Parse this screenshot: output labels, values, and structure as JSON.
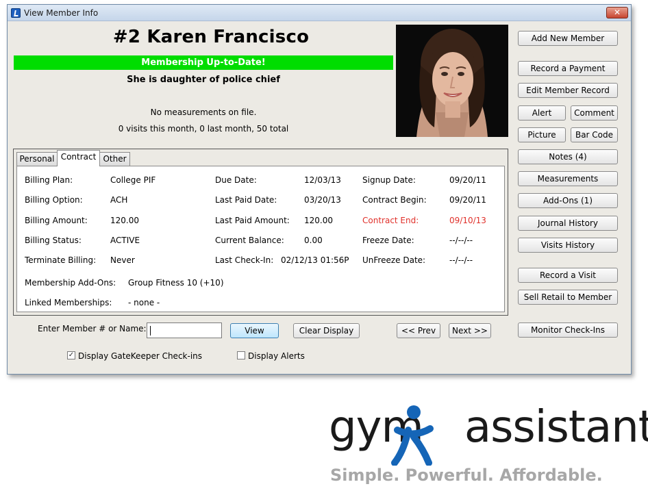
{
  "window": {
    "title": "View Member Info",
    "close_glyph": "✕"
  },
  "member": {
    "name": "#2  Karen Francisco",
    "status": "Membership Up-to-Date!",
    "status_color": "#00dd00",
    "note": "She is daughter of police chief",
    "measurements": "No measurements on file.",
    "visits": "0 visits this month, 0 last month, 50 total"
  },
  "tabs": [
    {
      "label": "Personal"
    },
    {
      "label": "Contract"
    },
    {
      "label": "Other"
    }
  ],
  "active_tab": "Contract",
  "contract": {
    "billing_plan": {
      "label": "Billing Plan:",
      "value": "College PIF"
    },
    "billing_option": {
      "label": "Billing Option:",
      "value": "ACH"
    },
    "billing_amount": {
      "label": "Billing Amount:",
      "value": "120.00"
    },
    "billing_status": {
      "label": "Billing Status:",
      "value": "ACTIVE"
    },
    "terminate_billing": {
      "label": "Terminate Billing:",
      "value": "Never"
    },
    "due_date": {
      "label": "Due Date:",
      "value": "12/03/13"
    },
    "last_paid_date": {
      "label": "Last Paid Date:",
      "value": "03/20/13"
    },
    "last_paid_amount": {
      "label": "Last Paid Amount:",
      "value": "120.00"
    },
    "current_balance": {
      "label": "Current Balance:",
      "value": "0.00"
    },
    "last_checkin": {
      "label": "Last Check-In:",
      "value": "02/12/13 01:56P"
    },
    "signup_date": {
      "label": "Signup Date:",
      "value": "09/20/11"
    },
    "contract_begin": {
      "label": "Contract Begin:",
      "value": "09/20/11"
    },
    "contract_end": {
      "label": "Contract End:",
      "value": "09/10/13"
    },
    "freeze_date": {
      "label": "Freeze Date:",
      "value": "--/--/--"
    },
    "unfreeze_date": {
      "label": "UnFreeze Date:",
      "value": "--/--/--"
    },
    "membership_addons": {
      "label": "Membership Add-Ons:",
      "value": "Group Fitness 10 (+10)"
    },
    "linked_memberships": {
      "label": "Linked Memberships:",
      "value": "- none -"
    },
    "alert_color": "#e0302a"
  },
  "side_buttons": {
    "add_new_member": "Add New Member",
    "record_payment": "Record a Payment",
    "edit_member_record": "Edit Member Record",
    "alert": "Alert",
    "comment": "Comment",
    "picture": "Picture",
    "bar_code": "Bar Code",
    "notes": "Notes (4)",
    "measurements": "Measurements",
    "add_ons": "Add-Ons (1)",
    "journal_history": "Journal History",
    "visits_history": "Visits History",
    "record_visit": "Record a Visit",
    "sell_retail": "Sell Retail to Member",
    "monitor_checkins": "Monitor Check-Ins"
  },
  "bottom": {
    "enter_label": "Enter Member # or Name:",
    "search_value": "",
    "view": "View",
    "clear_display": "Clear Display",
    "prev": "<< Prev",
    "next": "Next >>",
    "display_gatekeeper": "Display GateKeeper Check-ins",
    "display_gatekeeper_checked": true,
    "display_alerts": "Display Alerts",
    "display_alerts_checked": false
  },
  "brand": {
    "logo_left": "gym",
    "logo_right": "assistant",
    "slogan": "Simple.  Powerful.  Affordable.",
    "accent": "#1565b7"
  }
}
